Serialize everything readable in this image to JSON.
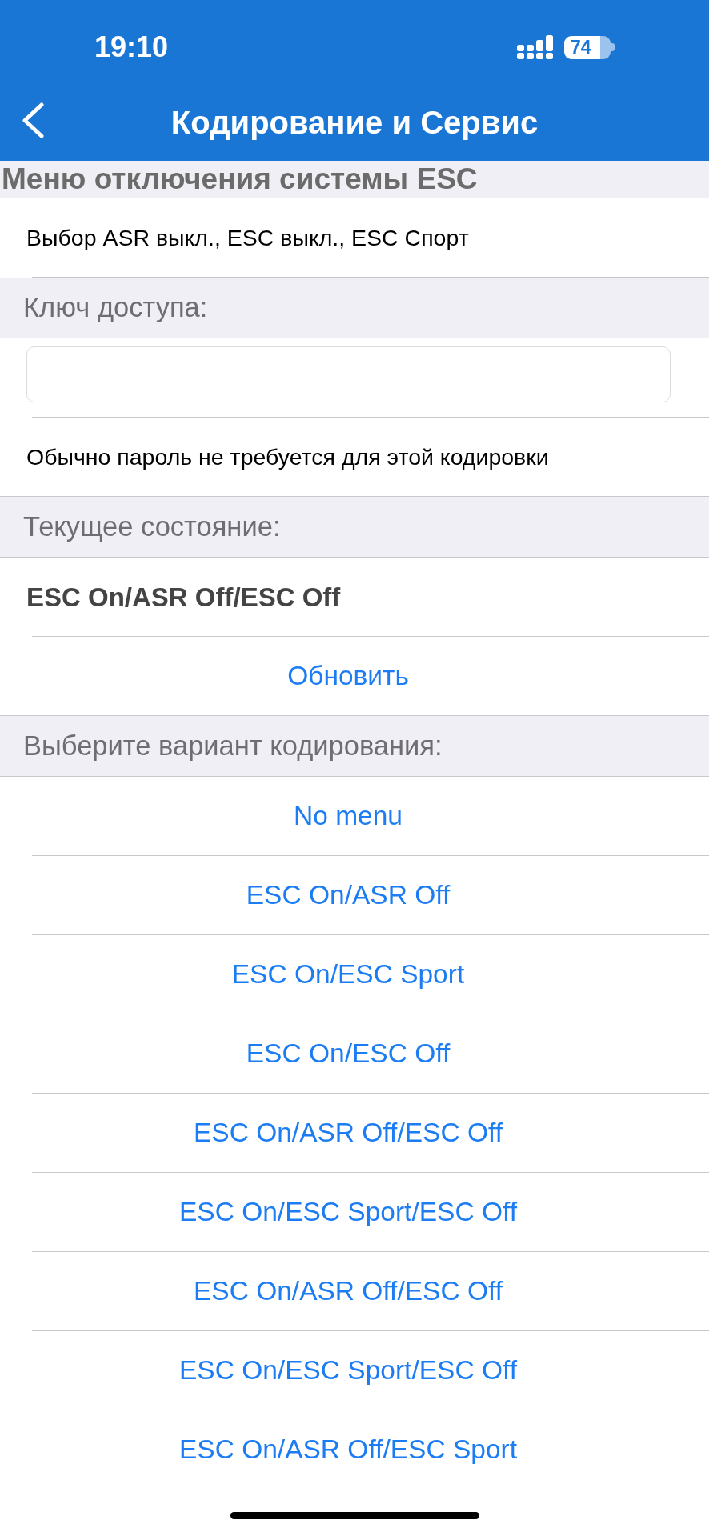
{
  "status_bar": {
    "time": "19:10",
    "battery": "74"
  },
  "nav_bar": {
    "title": "Кодирование и Сервис"
  },
  "heading": "Меню отключения системы ESC",
  "sections": [
    {
      "rows": [
        {
          "kind": "text",
          "text": "Выбор ASR выкл., ESC выкл., ESC Спорт"
        }
      ]
    },
    {
      "header": "Ключ доступа:",
      "rows": [
        {
          "kind": "input"
        },
        {
          "kind": "text",
          "text": "Обычно пароль не требуется для этой кодировки"
        }
      ]
    },
    {
      "header": "Текущее состояние:",
      "rows": [
        {
          "kind": "value",
          "text": "ESC On/ASR Off/ESC Off"
        },
        {
          "kind": "action",
          "text": "Обновить"
        }
      ]
    },
    {
      "header": "Выберите вариант кодирования:",
      "rows": [
        {
          "kind": "option",
          "text": "No menu"
        },
        {
          "kind": "option",
          "text": "ESC On/ASR Off"
        },
        {
          "kind": "option",
          "text": "ESC On/ESC Sport"
        },
        {
          "kind": "option",
          "text": "ESC On/ESC Off"
        },
        {
          "kind": "option",
          "text": "ESC On/ASR Off/ESC Off"
        },
        {
          "kind": "option",
          "text": "ESC On/ESC Sport/ESC Off"
        },
        {
          "kind": "option",
          "text": "ESC On/ASR Off/ESC Off"
        },
        {
          "kind": "option",
          "text": "ESC On/ESC Sport/ESC Off"
        },
        {
          "kind": "option",
          "text": "ESC On/ASR Off/ESC Sport"
        }
      ]
    }
  ]
}
